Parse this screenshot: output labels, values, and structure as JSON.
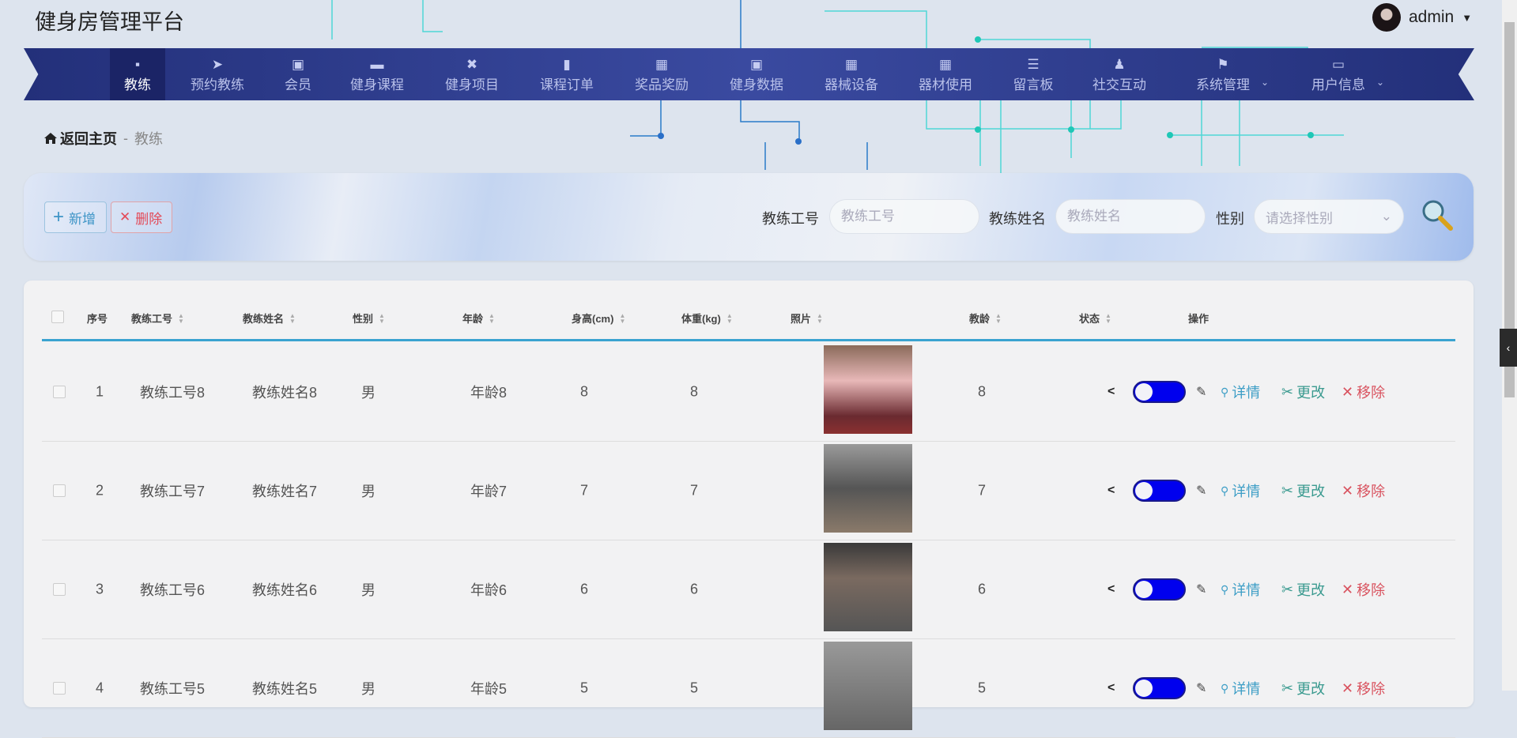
{
  "header": {
    "title": "健身房管理平台",
    "user": "admin",
    "user_caret": "▼"
  },
  "nav": {
    "items": [
      {
        "label": "教练",
        "icon": "chat-icon",
        "glyph": "▪",
        "active": true
      },
      {
        "label": "预约教练",
        "icon": "paper-plane-icon",
        "glyph": "➤"
      },
      {
        "label": "会员",
        "icon": "chart-card-icon",
        "glyph": "▣"
      },
      {
        "label": "健身课程",
        "icon": "briefcase-icon",
        "glyph": "▬"
      },
      {
        "label": "健身项目",
        "icon": "ticket-icon",
        "glyph": "✖"
      },
      {
        "label": "课程订单",
        "icon": "bar-chart-icon",
        "glyph": "▮"
      },
      {
        "label": "奖品奖励",
        "icon": "grid-icon",
        "glyph": "▦"
      },
      {
        "label": "健身数据",
        "icon": "clipboard-icon",
        "glyph": "▣"
      },
      {
        "label": "器械设备",
        "icon": "grid-icon",
        "glyph": "▦"
      },
      {
        "label": "器材使用",
        "icon": "grid-icon",
        "glyph": "▦"
      },
      {
        "label": "留言板",
        "icon": "sliders-icon",
        "glyph": "☰"
      },
      {
        "label": "社交互动",
        "icon": "stamp-icon",
        "glyph": "♟"
      },
      {
        "label": "系统管理",
        "icon": "flag-icon",
        "glyph": "⚑",
        "dropdown": true
      },
      {
        "label": "用户信息",
        "icon": "card-icon",
        "glyph": "▭",
        "dropdown": true
      }
    ],
    "chevron": "⌄"
  },
  "breadcrumb": {
    "home": "返回主页",
    "sep": "-",
    "current": "教练"
  },
  "toolbar": {
    "add": "新增",
    "add_icon": "+",
    "delete": "删除",
    "delete_icon": "✕"
  },
  "search": {
    "id_label": "教练工号",
    "id_placeholder": "教练工号",
    "id_value": "",
    "name_label": "教练姓名",
    "name_placeholder": "教练姓名",
    "name_value": "",
    "gender_label": "性别",
    "gender_placeholder": "请选择性别",
    "gender_caret": "⌄"
  },
  "table": {
    "headers": [
      "序号",
      "教练工号",
      "教练姓名",
      "性别",
      "年龄",
      "身高(cm)",
      "体重(kg)",
      "照片",
      "教龄",
      "状态",
      "操作"
    ],
    "rows": [
      {
        "idx": "1",
        "id": "教练工号8",
        "name": "教练姓名8",
        "gender": "男",
        "age": "年龄8",
        "height": "8",
        "weight": "8",
        "tenure": "8",
        "status_on": true
      },
      {
        "idx": "2",
        "id": "教练工号7",
        "name": "教练姓名7",
        "gender": "男",
        "age": "年龄7",
        "height": "7",
        "weight": "7",
        "tenure": "7",
        "status_on": true
      },
      {
        "idx": "3",
        "id": "教练工号6",
        "name": "教练姓名6",
        "gender": "男",
        "age": "年龄6",
        "height": "6",
        "weight": "6",
        "tenure": "6",
        "status_on": true
      },
      {
        "idx": "4",
        "id": "教练工号5",
        "name": "教练姓名5",
        "gender": "男",
        "age": "年龄5",
        "height": "5",
        "weight": "5",
        "tenure": "5",
        "status_on": true
      }
    ],
    "actions": {
      "detail": "详情",
      "edit": "更改",
      "remove": "移除",
      "detail_icon": "⚲",
      "edit_icon": "✂",
      "remove_icon": "✕",
      "share_icon": "<",
      "pencil_icon": "✎"
    }
  },
  "colors": {
    "nav": "#2f3d8f",
    "accent": "#3aa3d0",
    "toggle": "#0000ee",
    "detail": "#3d9ec6",
    "edit": "#3a9a8f",
    "remove": "#d9535f"
  }
}
